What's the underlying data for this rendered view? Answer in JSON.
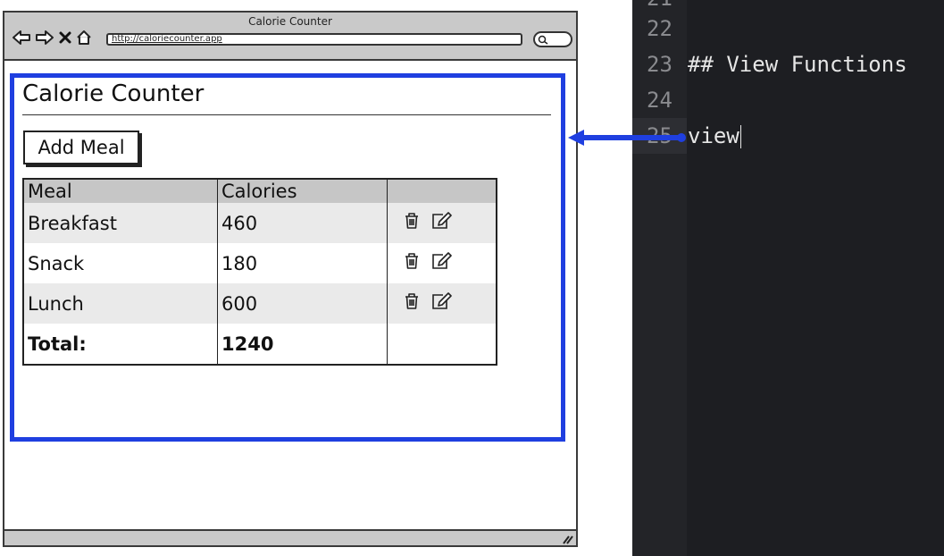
{
  "browser": {
    "window_title": "Calorie Counter",
    "url": "http://caloriecounter.app"
  },
  "app": {
    "title": "Calorie Counter",
    "add_button_label": "Add Meal",
    "table": {
      "headers": [
        "Meal",
        "Calories",
        ""
      ],
      "rows": [
        {
          "meal": "Breakfast",
          "calories": "460"
        },
        {
          "meal": "Snack",
          "calories": "180"
        },
        {
          "meal": "Lunch",
          "calories": "600"
        }
      ],
      "total": {
        "label": "Total:",
        "value": "1240"
      },
      "row_actions": [
        "trash-icon",
        "edit-icon"
      ]
    }
  },
  "editor": {
    "lines": [
      {
        "number": "22",
        "text": ""
      },
      {
        "number": "23",
        "text": "## View Functions"
      },
      {
        "number": "24",
        "text": ""
      },
      {
        "number": "25",
        "text": "view"
      }
    ],
    "active_line": "25"
  },
  "colors": {
    "highlight": "#1f3fe0",
    "editor_bg": "#1d1e22",
    "chrome_gray": "#c9c9c9"
  }
}
